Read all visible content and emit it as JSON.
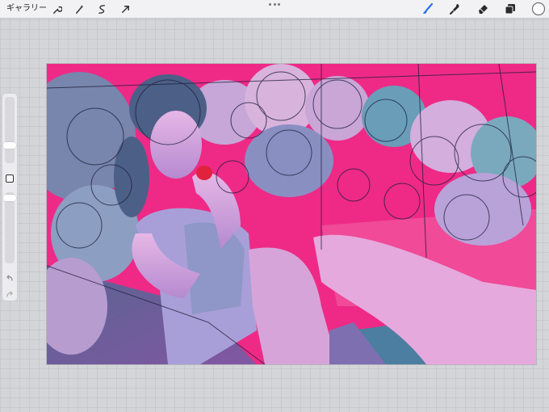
{
  "toolbar": {
    "gallery_label": "ギャラリー",
    "left_tools": [
      "wrench-icon",
      "magic-wand-icon",
      "selection-icon",
      "transform-arrow-icon"
    ],
    "right_tools": [
      "brush-icon",
      "smudge-icon",
      "eraser-icon",
      "layers-icon",
      "color-icon"
    ],
    "accent_color": "#2a6ff2",
    "current_color": "#ffffff"
  },
  "canvas": {
    "dominant_colors": [
      "#ee2a86",
      "#5b8fae",
      "#c89ad8"
    ]
  },
  "sidebar": {
    "brush_size_level": 0.35,
    "opacity_level": 0.6,
    "icons": [
      "modify-square-icon",
      "undo-icon",
      "redo-icon"
    ]
  }
}
